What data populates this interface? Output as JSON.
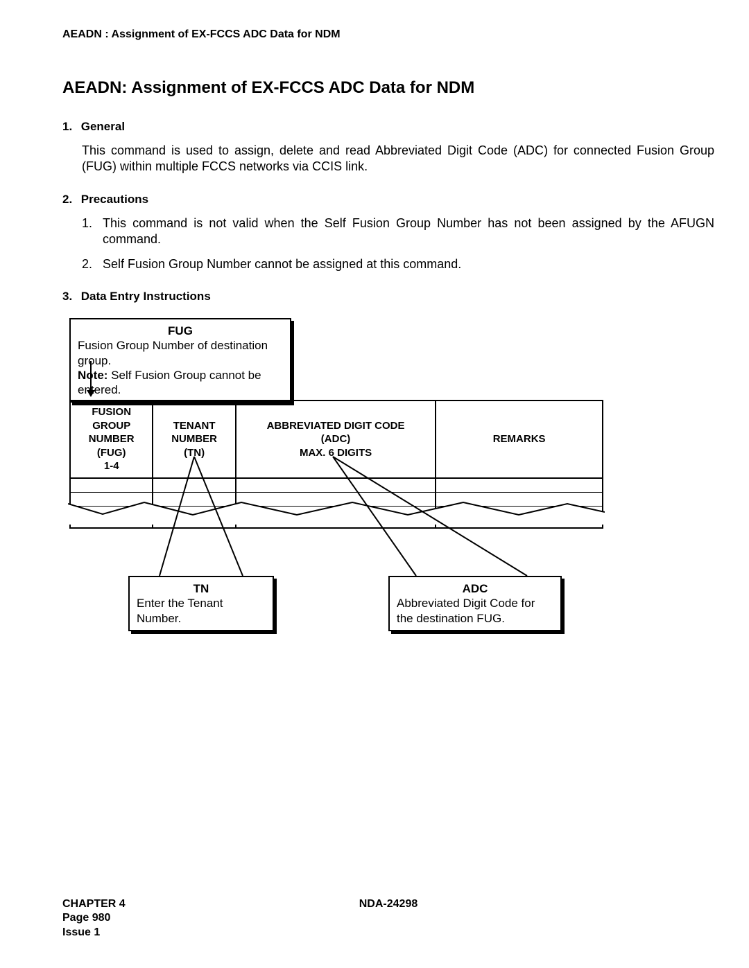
{
  "running_head": "AEADN : Assignment of EX-FCCS ADC Data for NDM",
  "title": "AEADN: Assignment of EX-FCCS ADC Data for NDM",
  "sections": {
    "general": {
      "num": "1.",
      "label": "General",
      "body": "This command is used to assign, delete and read Abbreviated Digit Code (ADC) for connected Fusion Group (FUG) within multiple FCCS networks via CCIS link."
    },
    "precautions": {
      "num": "2.",
      "label": "Precautions",
      "items": [
        {
          "num": "1.",
          "text": "This command is not valid when the Self Fusion Group Number has not been assigned by the AFUGN command."
        },
        {
          "num": "2.",
          "text": "Self Fusion Group Number cannot be assigned at this command."
        }
      ]
    },
    "data_entry": {
      "num": "3.",
      "label": "Data Entry Instructions"
    }
  },
  "callouts": {
    "fug": {
      "title": "FUG",
      "line1": "Fusion Group Number of destination group.",
      "note_label": "Note:",
      "note_text": " Self Fusion Group cannot be entered."
    },
    "tn": {
      "title": "TN",
      "text": "Enter the Tenant Number."
    },
    "adc": {
      "title": "ADC",
      "text": "Abbreviated Digit Code for the destination FUG."
    }
  },
  "table_headers": {
    "fug": {
      "l1": "FUSION GROUP",
      "l2": "NUMBER",
      "l3": "(FUG)",
      "l4": "1-4"
    },
    "tn": {
      "l1": "TENANT",
      "l2": "NUMBER",
      "l3": "(TN)"
    },
    "adc": {
      "l1": "ABBREVIATED DIGIT CODE",
      "l2": "(ADC)",
      "l3": "MAX. 6 DIGITS"
    },
    "rem": {
      "l1": "REMARKS"
    }
  },
  "footer": {
    "chapter": "CHAPTER 4",
    "doc": "NDA-24298",
    "page": "Page 980",
    "issue": "Issue 1"
  }
}
